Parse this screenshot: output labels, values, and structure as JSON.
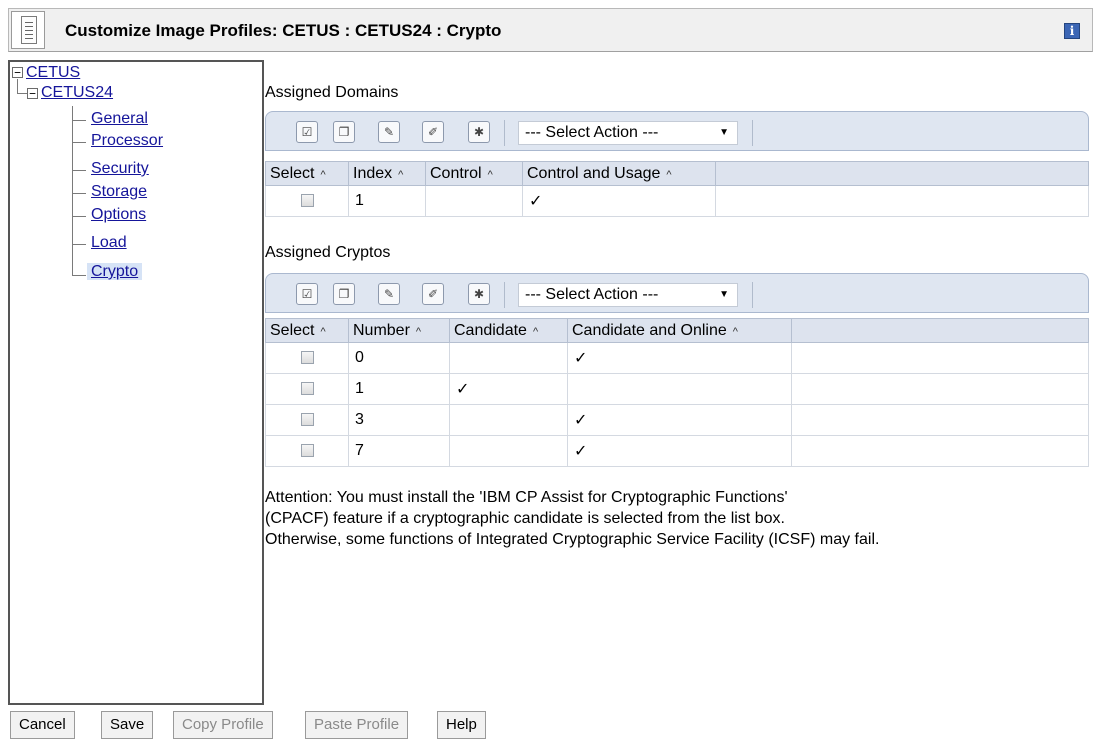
{
  "window": {
    "title": "Customize Image Profiles: CETUS : CETUS24 : Crypto",
    "info_icon_glyph": "i"
  },
  "tree": {
    "root": "CETUS",
    "child": "CETUS24",
    "items": [
      {
        "label": "General"
      },
      {
        "label": "Processor"
      },
      {
        "label": "Security"
      },
      {
        "label": "Storage"
      },
      {
        "label": "Options"
      },
      {
        "label": "Load"
      },
      {
        "label": "Crypto",
        "selected": true
      }
    ]
  },
  "domains": {
    "title": "Assigned Domains",
    "select_action": "--- Select Action ---",
    "columns": [
      "Select",
      "Index",
      "Control",
      "Control and Usage"
    ],
    "rows": [
      {
        "index": "1",
        "control": "",
        "control_usage": "✓"
      }
    ]
  },
  "cryptos": {
    "title": "Assigned Cryptos",
    "select_action": "--- Select Action ---",
    "columns": [
      "Select",
      "Number",
      "Candidate",
      "Candidate and Online"
    ],
    "rows": [
      {
        "number": "0",
        "candidate": "",
        "candidate_online": "✓"
      },
      {
        "number": "1",
        "candidate": "✓",
        "candidate_online": ""
      },
      {
        "number": "3",
        "candidate": "",
        "candidate_online": "✓"
      },
      {
        "number": "7",
        "candidate": "",
        "candidate_online": "✓"
      }
    ]
  },
  "attention": {
    "line1": "Attention: You must install the 'IBM CP Assist for Cryptographic Functions'",
    "line2": "(CPACF) feature if a cryptographic candidate is selected from the list box.",
    "line3": "Otherwise, some functions of Integrated Cryptographic Service Facility (ICSF) may fail."
  },
  "buttons": {
    "cancel": "Cancel",
    "save": "Save",
    "copy_profile": "Copy Profile",
    "paste_profile": "Paste Profile",
    "help": "Help"
  },
  "sort_glyph": "^",
  "colors": {
    "link": "#15159a",
    "toolbar_bg": "#dfe6f1",
    "header_bg": "#dde3ee",
    "selected_bg": "#d6e3f6"
  }
}
